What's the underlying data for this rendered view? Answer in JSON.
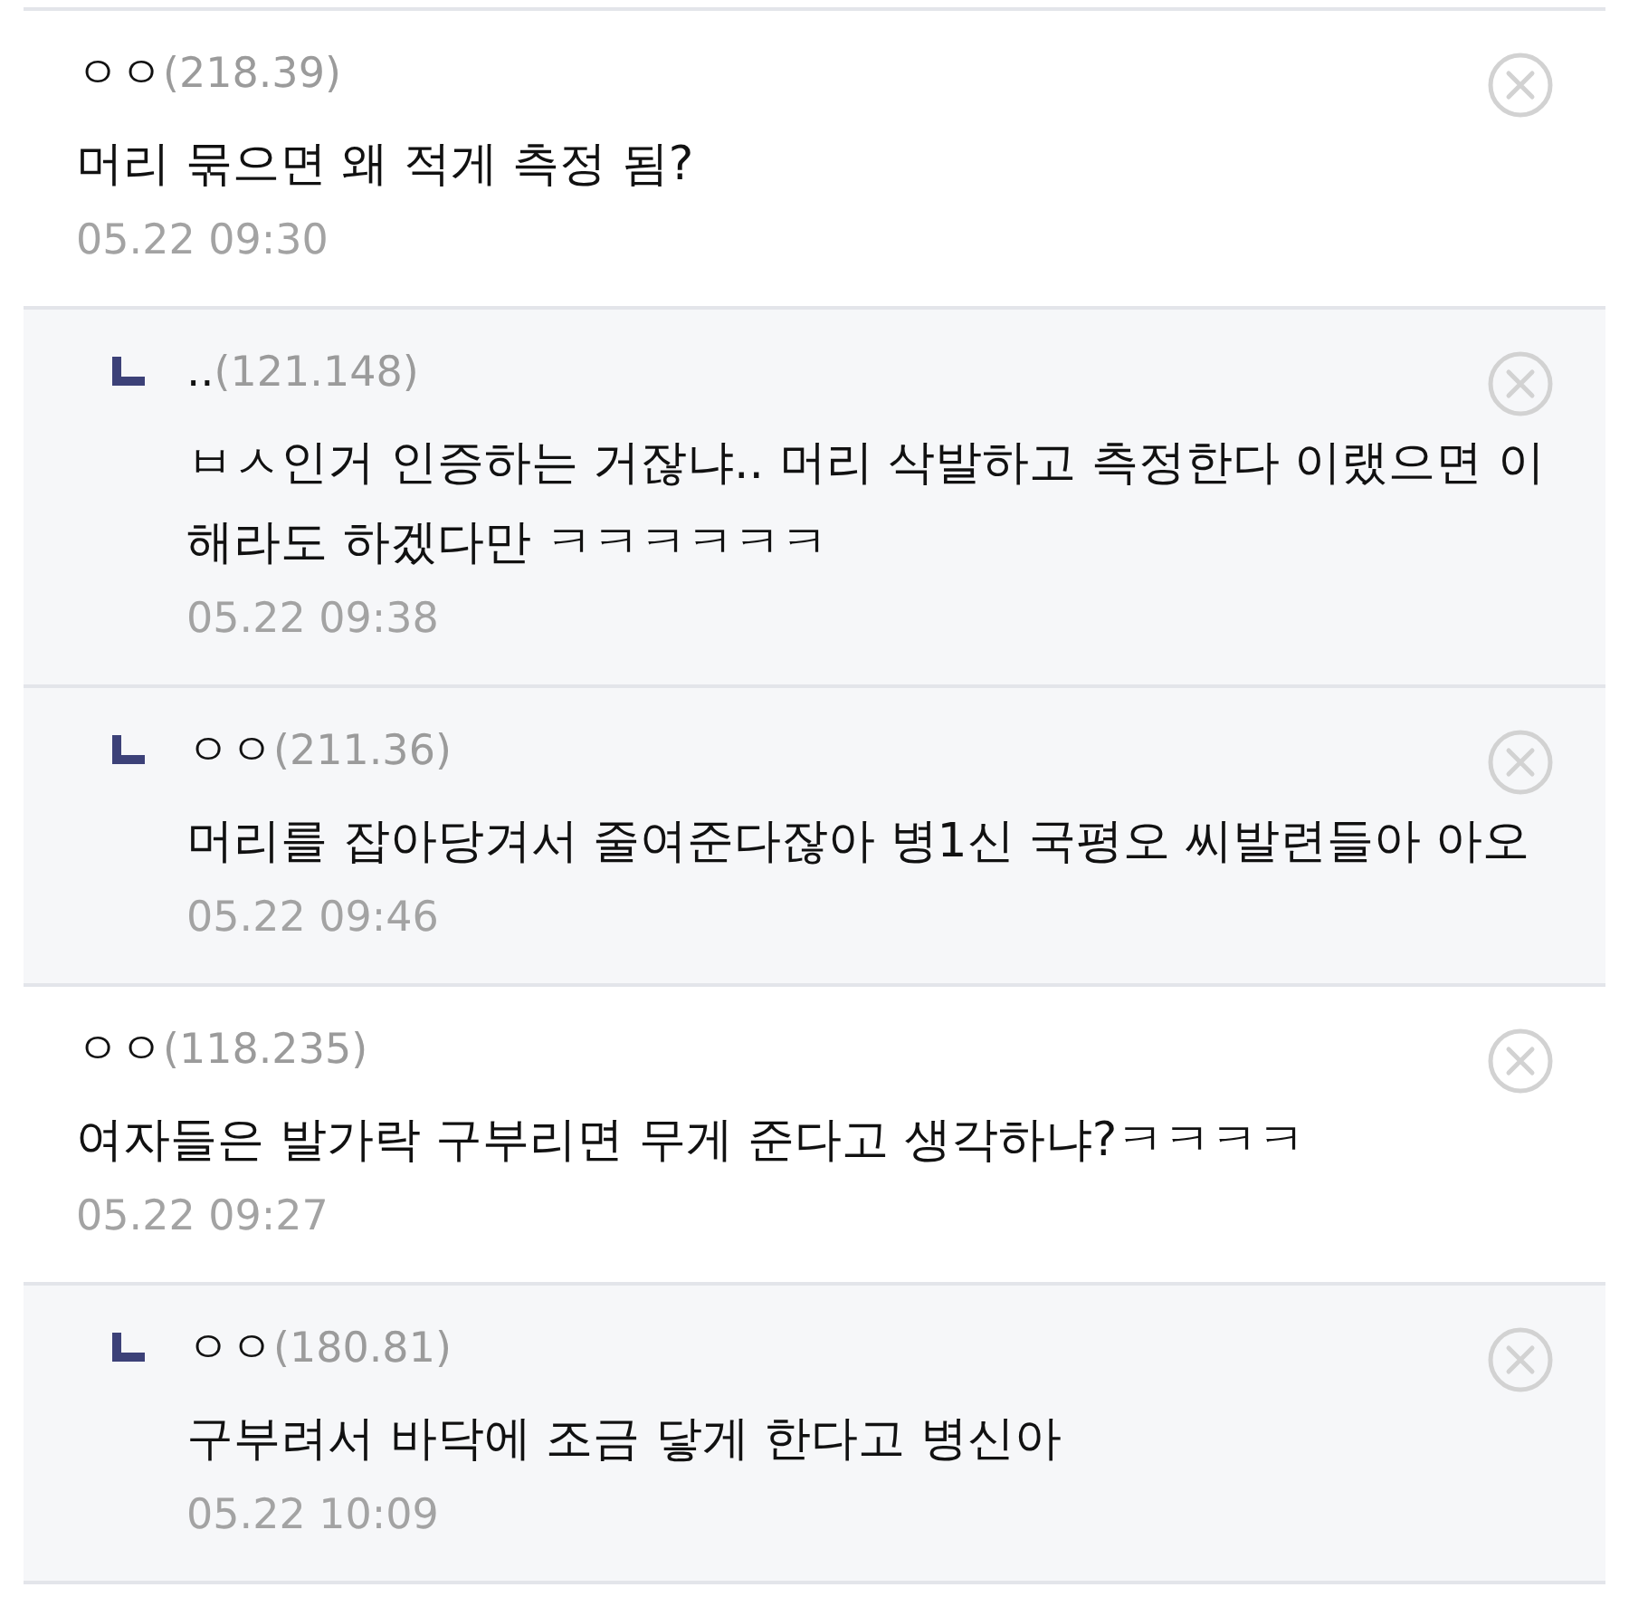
{
  "comments": [
    {
      "nickname": "ㅇㅇ",
      "ip": "(218.39)",
      "body": "머리 묶으면 왜 적게 측정 됨?",
      "date": "05.22 09:30",
      "replies": [
        {
          "nickname": "..",
          "ip": "(121.148)",
          "body": "ㅂㅅ인거 인증하는 거잖냐.. 머리 삭발하고 측정한다 이랬으면 이해라도 하겠다만 ㅋㅋㅋㅋㅋㅋ",
          "date": "05.22 09:38"
        },
        {
          "nickname": "ㅇㅇ",
          "ip": "(211.36)",
          "body": "머리를 잡아당겨서 줄여준다잖아 병1신 국평오 씨발련들아 아오",
          "date": "05.22 09:46"
        }
      ]
    },
    {
      "nickname": "ㅇㅇ",
      "ip": "(118.235)",
      "body": "여자들은 발가락 구부리면 무게 준다고 생각하냐?ㅋㅋㅋㅋ",
      "date": "05.22 09:27",
      "replies": [
        {
          "nickname": "ㅇㅇ",
          "ip": "(180.81)",
          "body": "구부려서 바닥에 조금 닿게 한다고 병신아",
          "date": "05.22 10:09"
        }
      ]
    }
  ]
}
